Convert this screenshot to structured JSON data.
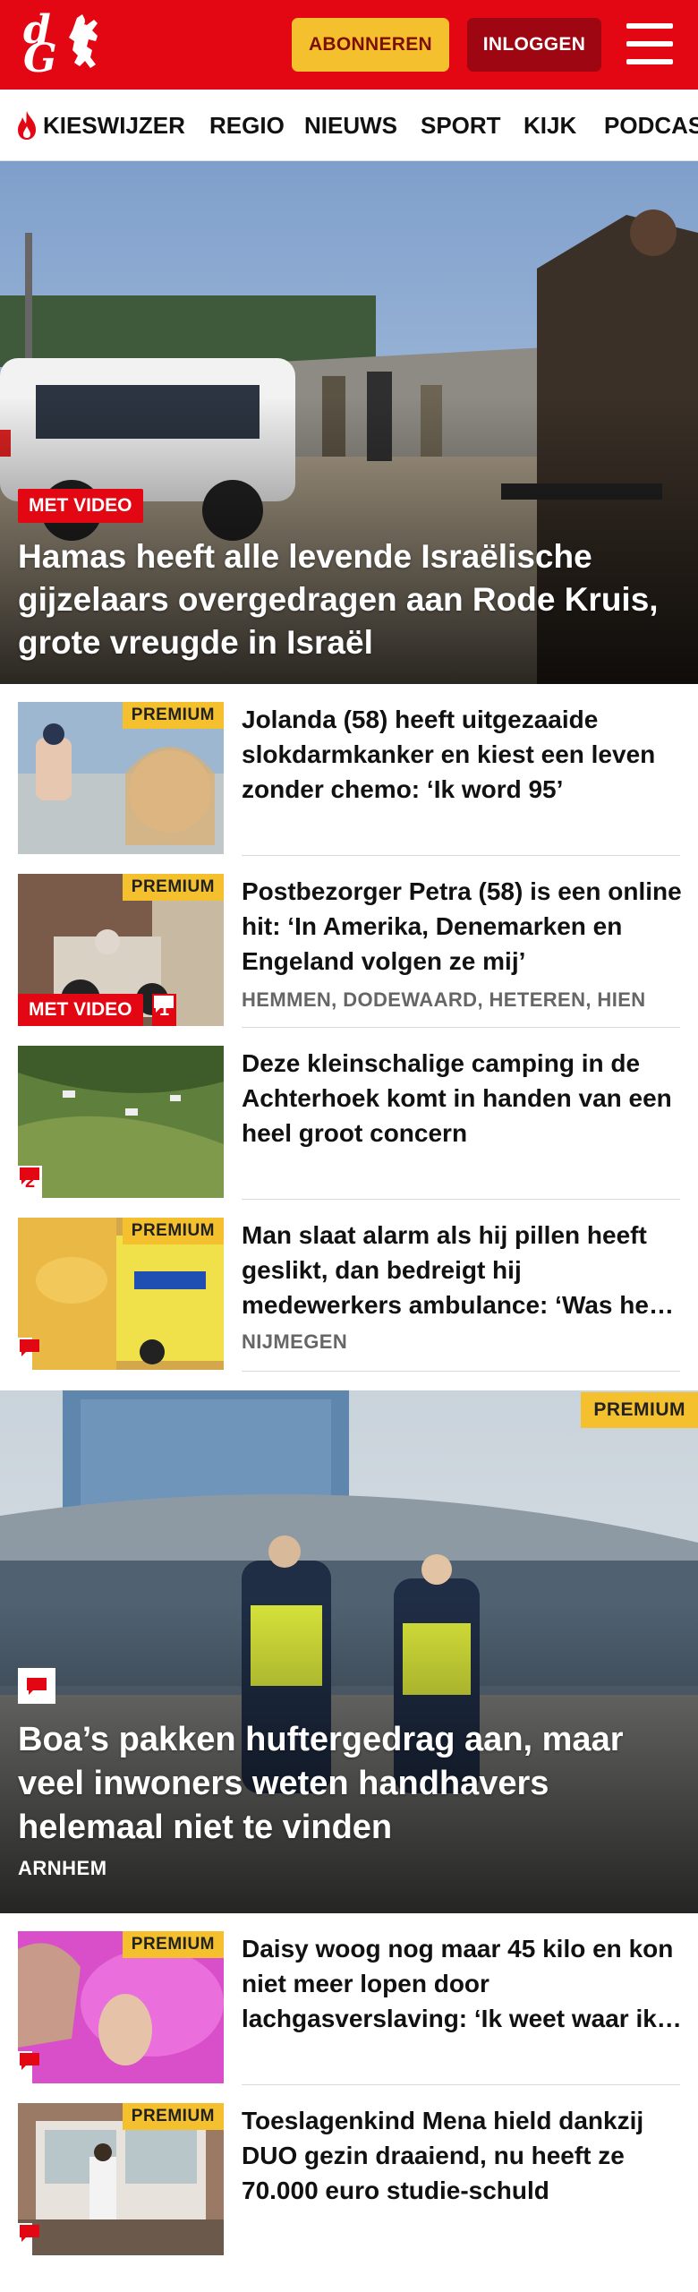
{
  "header": {
    "logo_text_top": "d",
    "logo_text_bottom": "G",
    "subscribe_label": "ABONNEREN",
    "login_label": "INLOGGEN",
    "brand_color": "#e30613",
    "subscribe_color": "#f5c02e"
  },
  "nav": {
    "items": [
      {
        "label": "KIESWIJZER",
        "icon": "flame-icon"
      },
      {
        "label": "REGIO"
      },
      {
        "label": "NIEUWS"
      },
      {
        "label": "SPORT"
      },
      {
        "label": "KIJK"
      },
      {
        "label": "PODCAST"
      }
    ]
  },
  "hero": {
    "tag": "MET VIDEO",
    "title": "Hamas heeft alle levende Israëlische gijzelaars overgedragen aan Rode Kruis, grote vreugde in Israël"
  },
  "articles": [
    {
      "premium": "PREMIUM",
      "title": "Jolanda (58) heeft uitgezaaide slokdarmkanker en kiest een leven zonder chemo: ‘Ik word 95’",
      "location": "",
      "video_tag": "",
      "comments": ""
    },
    {
      "premium": "PREMIUM",
      "title": "Postbezorger Petra (58) is een online hit: ‘In Amerika, Denemarken en Engeland volgen ze mij’",
      "location": "HEMMEN, DODEWAARD, HETEREN, HIEN",
      "video_tag": "MET VIDEO",
      "comments": "1"
    },
    {
      "premium": "",
      "title": "Deze kleinschalige camping in de Achterhoek komt in handen van een heel groot concern",
      "location": "",
      "video_tag": "",
      "comments": "2"
    },
    {
      "premium": "PREMIUM",
      "title": "Man slaat alarm als hij pillen heeft geslikt, dan bedreigt hij medewerkers ambulance: ‘Was heel eng’",
      "location": "NIJMEGEN",
      "video_tag": "",
      "comments": ""
    }
  ],
  "feature": {
    "premium": "PREMIUM",
    "title": "Boa’s pakken huftergedrag aan, maar veel inwoners weten handhavers helemaal niet te vinden",
    "location": "ARNHEM"
  },
  "articles_bottom": [
    {
      "premium": "PREMIUM",
      "title": "Daisy woog nog maar 45 kilo en kon niet meer lopen door lachgasverslaving: ‘Ik weet waar ik was’",
      "location": ""
    },
    {
      "premium": "PREMIUM",
      "title": "Toeslagenkind Mena hield dankzij DUO gezin draaiend, nu heeft ze 70.000 euro studie-schuld",
      "location": ""
    }
  ]
}
